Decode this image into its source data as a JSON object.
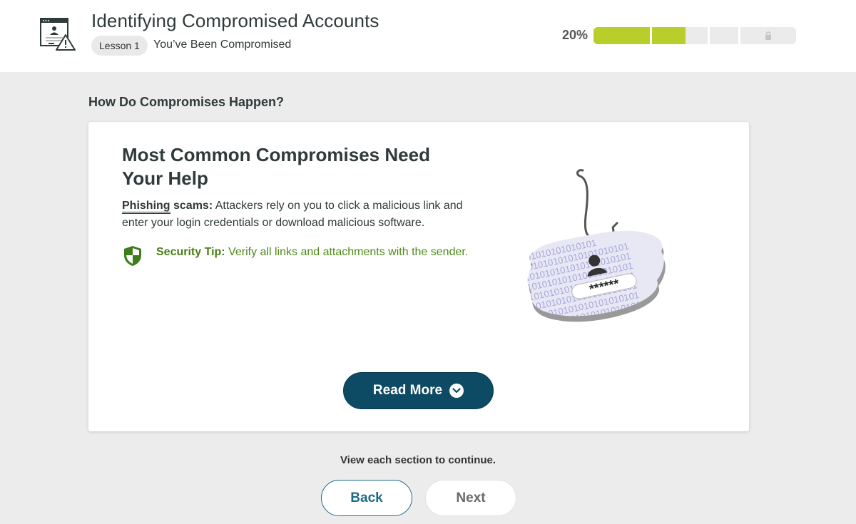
{
  "header": {
    "course_title": "Identifying Compromised Accounts",
    "lesson_badge": "Lesson 1",
    "lesson_name": "You’ve Been Compromised",
    "course_icon": "browser-warning-icon",
    "progress": {
      "label": "20%",
      "value_percent": 20,
      "segments": [
        {
          "fill": 1.0
        },
        {
          "fill": 0.6
        },
        {
          "fill": 0
        },
        {
          "fill": 0,
          "locked": true
        }
      ],
      "fill_color": "#b8ce2a",
      "lock_icon": "lock-icon"
    }
  },
  "section": {
    "title": "How Do Compromises Happen?"
  },
  "card": {
    "heading": "Most Common Compromises Need Your Help",
    "body_term": "Phishing",
    "body_term_suffix": " scams:",
    "body_text": " Attackers rely on you to click a malicious link and enter your login credentials or download malicious software.",
    "tip_icon": "shield-icon",
    "tip_label": "Security Tip:",
    "tip_text": " Verify all links and attachments with the sender.",
    "illustration": {
      "icon": "phishing-hook-credentials-illustration",
      "password_text": "******",
      "binary_text": "0101010101010101"
    },
    "read_more_label": "Read More",
    "read_more_icon": "chevron-down-circle-icon"
  },
  "footer": {
    "continue_note": "View each section to continue.",
    "back_label": "Back",
    "next_label": "Next"
  },
  "colors": {
    "primary": "#0d4a64",
    "accent_green": "#b8ce2a",
    "tip_green": "#4f8a1a",
    "background": "#ececec"
  }
}
